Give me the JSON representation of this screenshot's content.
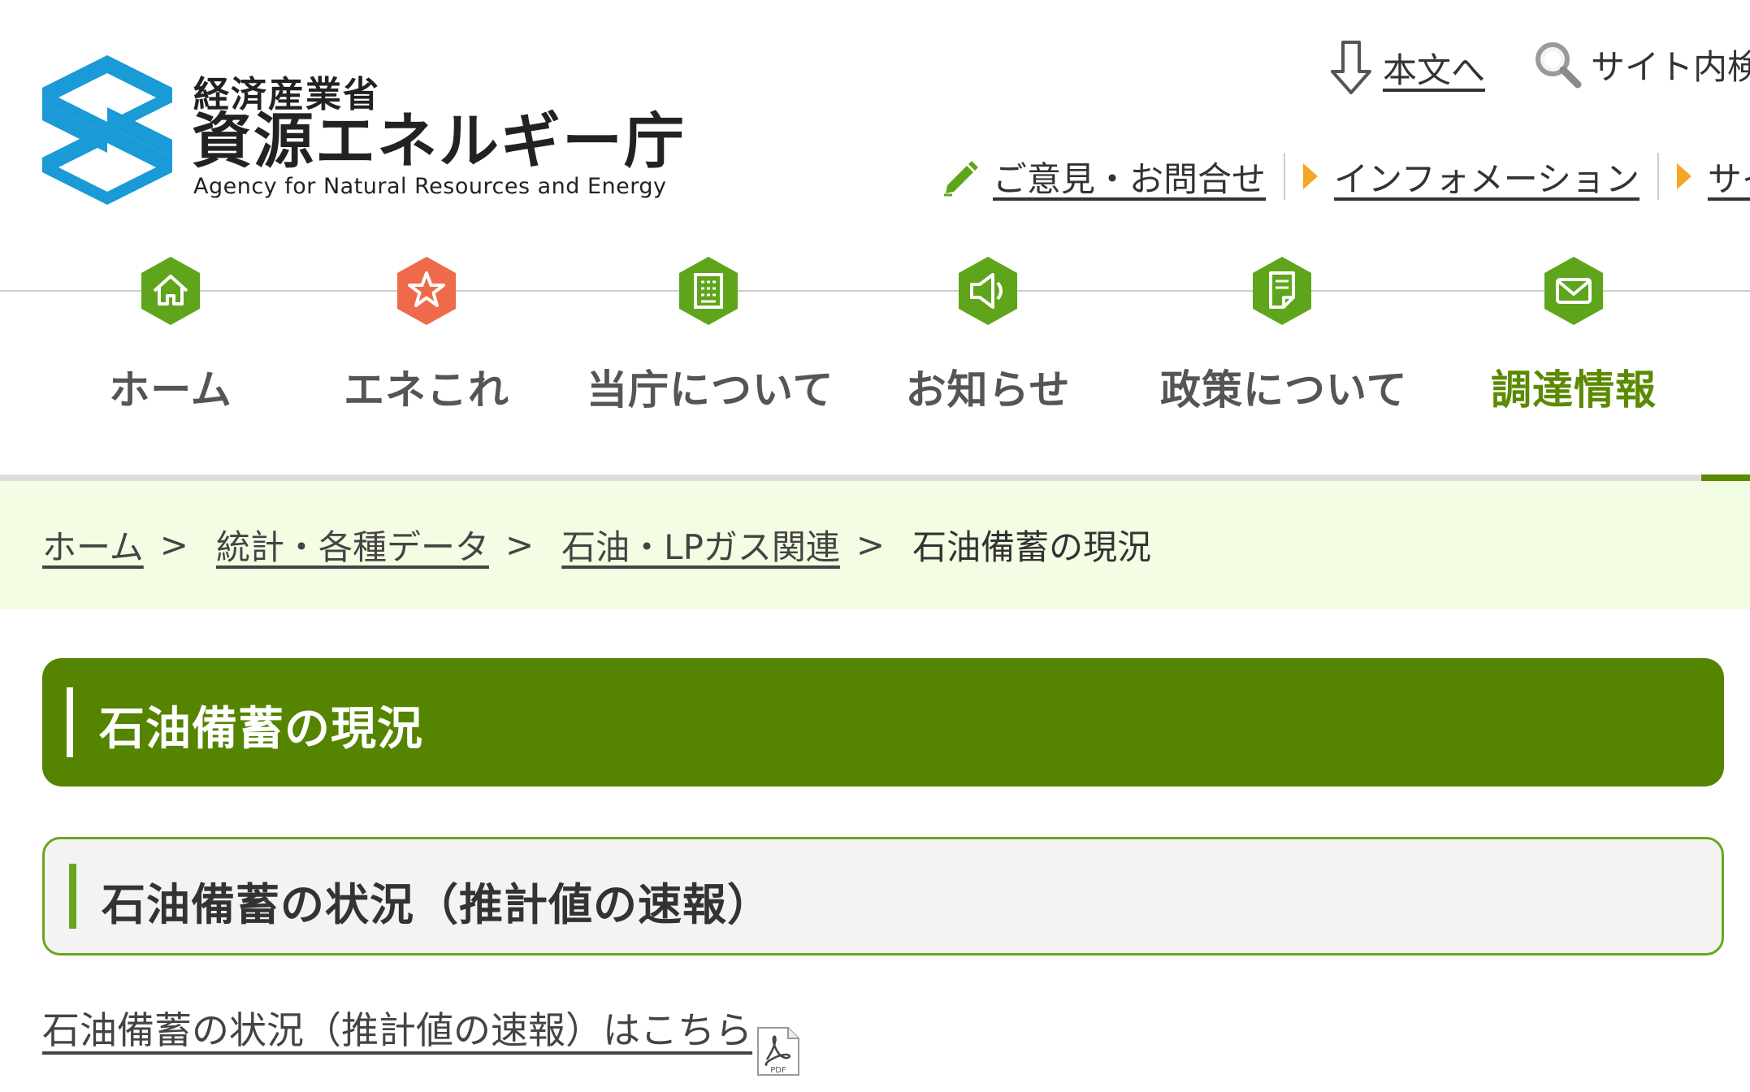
{
  "header": {
    "logo": {
      "ministry": "経済産業省",
      "agency": "資源エネルギー庁",
      "english": "Agency for Natural Resources and Energy"
    },
    "skip_link": {
      "label": "本文へ",
      "icon": "arrow-down-icon"
    },
    "site_search": {
      "label": "サイト内検",
      "icon": "magnifier-icon"
    },
    "util_nav": [
      {
        "label": "ご意見・お問合せ",
        "icon": "pencil-icon"
      },
      {
        "label": "インフォメーション",
        "icon": "triangle-right-icon"
      },
      {
        "label": "サイ",
        "icon": "triangle-right-icon"
      }
    ]
  },
  "global_nav": {
    "items": [
      {
        "label": "ホーム",
        "icon": "home-icon",
        "color": "#5fa51b"
      },
      {
        "label": "エネこれ",
        "icon": "star-icon",
        "color": "#ee6a4b"
      },
      {
        "label": "当庁について",
        "icon": "building-icon",
        "color": "#5fa51b"
      },
      {
        "label": "お知らせ",
        "icon": "megaphone-icon",
        "color": "#5fa51b"
      },
      {
        "label": "政策について",
        "icon": "document-icon",
        "color": "#5fa51b"
      },
      {
        "label": "調達情報",
        "icon": "envelope-icon",
        "color": "#5fa51b",
        "current": true
      }
    ]
  },
  "breadcrumb": {
    "items": [
      {
        "label": "ホーム"
      },
      {
        "label": "統計・各種データ"
      },
      {
        "label": "石油・LPガス関連"
      }
    ],
    "separator": ">",
    "current": "石油備蓄の現況"
  },
  "main": {
    "page_title": "石油備蓄の現況",
    "section_heading": "石油備蓄の状況（推計値の速報）",
    "report_link": "石油備蓄の状況（推計値の速報）はこちら",
    "report_link_icon": "pdf-file-icon",
    "pdf_badge": "PDF"
  },
  "colors": {
    "brand_green": "#548400",
    "accent_green": "#6aa51f",
    "breadcrumb_bg": "#f3fde3",
    "logo_blue": "#1a9ad6",
    "util_triangle": "#f5a623"
  }
}
